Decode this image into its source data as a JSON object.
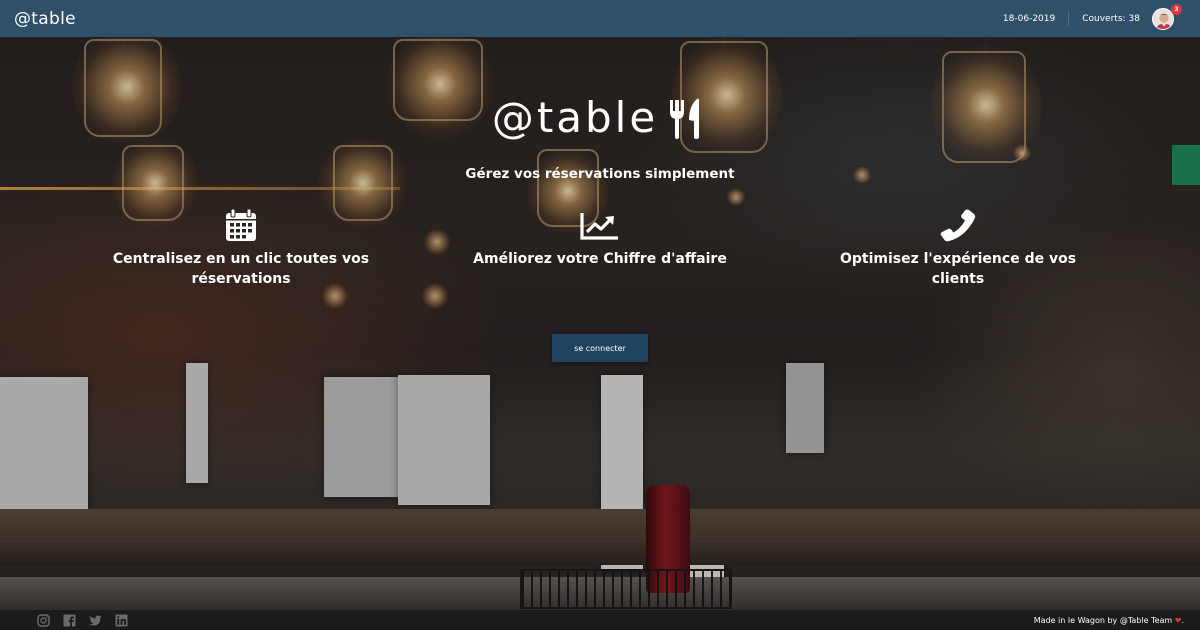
{
  "navbar": {
    "logo": "@table",
    "date": "18-06-2019",
    "covers_label": "Couverts:",
    "covers_value": "38",
    "notification_count": "3"
  },
  "hero": {
    "brand": "@table",
    "tagline": "Gérez vos réservations simplement",
    "features": [
      {
        "icon": "calendar-icon",
        "text": "Centralisez en un clic toutes vos réservations"
      },
      {
        "icon": "chart-line-icon",
        "text": "Améliorez votre Chiffre d'affaire"
      },
      {
        "icon": "phone-icon",
        "text": "Optimisez l'expérience de vos clients"
      }
    ],
    "cta_label": "se connecter"
  },
  "footer": {
    "social_icons": [
      "instagram-icon",
      "facebook-icon",
      "twitter-icon",
      "linkedin-icon"
    ],
    "credit_text": "Made in le Wagon by @Table Team",
    "credit_suffix": "."
  },
  "colors": {
    "navbar_bg": "#2f5069",
    "button_bg": "#1f4360",
    "footer_bg": "#1b1b1c",
    "accent_red": "#e0353f"
  }
}
